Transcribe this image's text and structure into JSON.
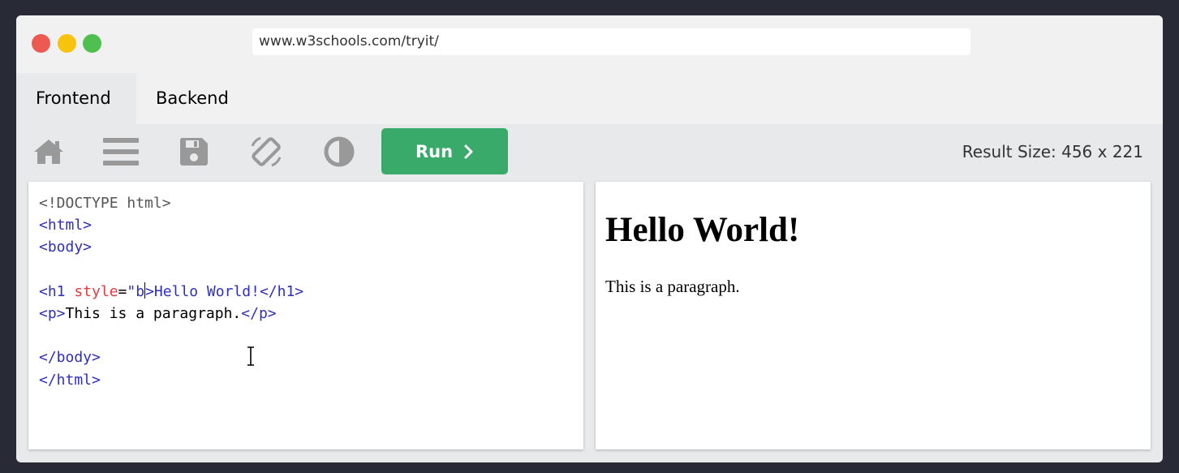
{
  "window": {
    "url": "www.w3schools.com/tryit/",
    "controls": [
      "close",
      "minimize",
      "maximize"
    ],
    "colors": {
      "close": "#ec5a52",
      "minimize": "#f8c30d",
      "maximize": "#4fbf4f"
    }
  },
  "tabs": [
    {
      "label": "Frontend",
      "active": true
    },
    {
      "label": "Backend",
      "active": false
    }
  ],
  "toolbar": {
    "icons": [
      "home-icon",
      "menu-icon",
      "save-icon",
      "rotate-icon",
      "contrast-icon"
    ],
    "run_label": "Run",
    "run_color": "#3aaa6a",
    "result_size": "Result Size: 456 x 221"
  },
  "editor": {
    "lines": [
      [
        {
          "t": "<!DOCTYPE html>",
          "c": "doc"
        }
      ],
      [
        {
          "t": "<html>",
          "c": "tag"
        }
      ],
      [
        {
          "t": "<body>",
          "c": "tag"
        }
      ],
      [],
      [
        {
          "t": "<h1",
          "c": "tag"
        },
        {
          "t": " style",
          "c": "attr"
        },
        {
          "t": "=",
          "c": "txt"
        },
        {
          "t": "\"b",
          "c": "val"
        },
        {
          "t": "|",
          "c": "caret"
        },
        {
          "t": ">Hello World!</h1>",
          "c": "tag"
        }
      ],
      [
        {
          "t": "<p>",
          "c": "tag"
        },
        {
          "t": "This is a paragraph.",
          "c": "txt"
        },
        {
          "t": "</p>",
          "c": "tag"
        }
      ],
      [],
      [
        {
          "t": "</body>",
          "c": "tag"
        }
      ],
      [
        {
          "t": "</html>",
          "c": "tag"
        }
      ]
    ]
  },
  "result": {
    "heading": "Hello World!",
    "paragraph": "This is a paragraph."
  }
}
